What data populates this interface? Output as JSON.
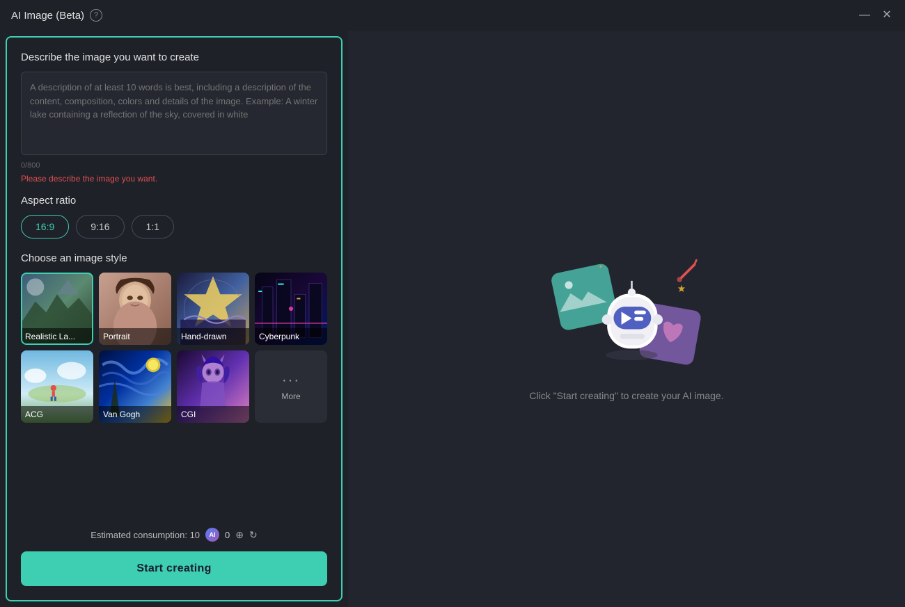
{
  "titleBar": {
    "title": "AI Image (Beta)",
    "minimizeLabel": "—",
    "closeLabel": "✕"
  },
  "leftPanel": {
    "descSection": {
      "title": "Describe the image you want to create",
      "placeholder": "A description of at least 10 words is best, including a description of the content, composition, colors and details of the image. Example: A winter lake containing a reflection of the sky, covered in white",
      "charCount": "0/800",
      "errorText": "Please describe the image you want."
    },
    "aspectRatio": {
      "title": "Aspect ratio",
      "options": [
        "16:9",
        "9:16",
        "1:1"
      ],
      "selected": "16:9"
    },
    "imageStyle": {
      "title": "Choose an image style",
      "styles": [
        {
          "id": "realistic",
          "label": "Realistic La...",
          "selected": true
        },
        {
          "id": "portrait",
          "label": "Portrait",
          "selected": false
        },
        {
          "id": "handdrawn",
          "label": "Hand-drawn",
          "selected": false
        },
        {
          "id": "cyberpunk",
          "label": "Cyberpunk",
          "selected": false
        },
        {
          "id": "acg",
          "label": "ACG",
          "selected": false
        },
        {
          "id": "vangogh",
          "label": "Van Gogh",
          "selected": false
        },
        {
          "id": "cgi",
          "label": "CGI",
          "selected": false
        }
      ],
      "moreLabel": "More"
    },
    "bottomBar": {
      "consumptionText": "Estimated consumption: 10",
      "creditCount": "0",
      "startLabel": "Start creating"
    }
  },
  "rightPanel": {
    "hintText": "Click \"Start creating\" to create your AI image."
  }
}
